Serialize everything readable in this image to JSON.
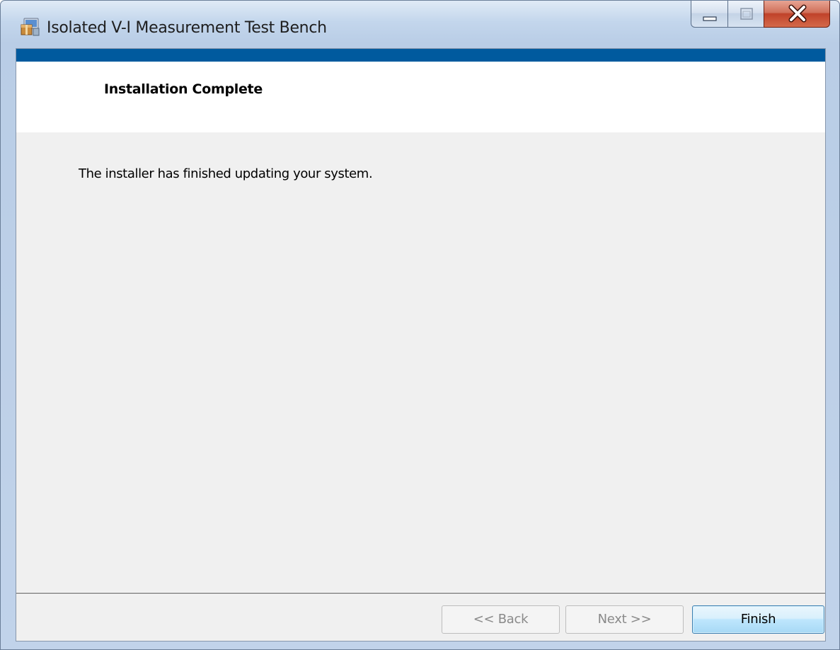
{
  "window": {
    "title": "Isolated V-I Measurement Test Bench",
    "icon": "installer-package-icon",
    "controls": {
      "minimize_icon": "minimize-icon",
      "maximize_icon": "maximize-icon",
      "close_icon": "close-icon"
    }
  },
  "colors": {
    "accent_bar": "#005a9e",
    "banner_bg": "#ffffff",
    "body_bg": "#f0f0f0",
    "close_button": "#c0422a"
  },
  "banner": {
    "title": "Installation Complete"
  },
  "body": {
    "message": "The installer has finished updating your system."
  },
  "buttons": {
    "back_label": "<< Back",
    "back_enabled": false,
    "next_label": "Next >>",
    "next_enabled": false,
    "finish_label": "Finish",
    "finish_enabled": true
  }
}
